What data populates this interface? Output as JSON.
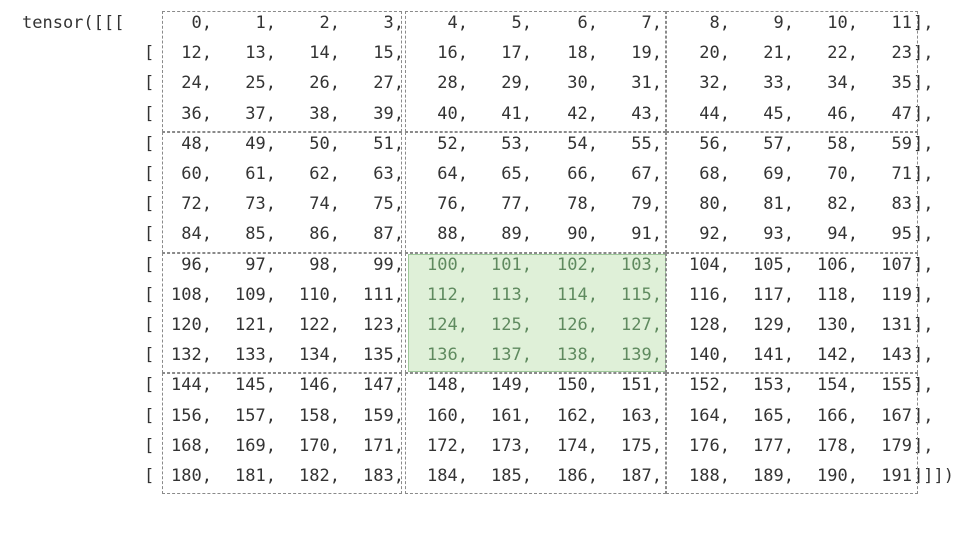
{
  "prefix": "tensor([[[",
  "suffix": "]])",
  "rows": [
    [
      "0",
      "1",
      "2",
      "3",
      "4",
      "5",
      "6",
      "7",
      "8",
      "9",
      "10",
      "11"
    ],
    [
      "12",
      "13",
      "14",
      "15",
      "16",
      "17",
      "18",
      "19",
      "20",
      "21",
      "22",
      "23"
    ],
    [
      "24",
      "25",
      "26",
      "27",
      "28",
      "29",
      "30",
      "31",
      "32",
      "33",
      "34",
      "35"
    ],
    [
      "36",
      "37",
      "38",
      "39",
      "40",
      "41",
      "42",
      "43",
      "44",
      "45",
      "46",
      "47"
    ],
    [
      "48",
      "49",
      "50",
      "51",
      "52",
      "53",
      "54",
      "55",
      "56",
      "57",
      "58",
      "59"
    ],
    [
      "60",
      "61",
      "62",
      "63",
      "64",
      "65",
      "66",
      "67",
      "68",
      "69",
      "70",
      "71"
    ],
    [
      "72",
      "73",
      "74",
      "75",
      "76",
      "77",
      "78",
      "79",
      "80",
      "81",
      "82",
      "83"
    ],
    [
      "84",
      "85",
      "86",
      "87",
      "88",
      "89",
      "90",
      "91",
      "92",
      "93",
      "94",
      "95"
    ],
    [
      "96",
      "97",
      "98",
      "99",
      "100",
      "101",
      "102",
      "103",
      "104",
      "105",
      "106",
      "107"
    ],
    [
      "108",
      "109",
      "110",
      "111",
      "112",
      "113",
      "114",
      "115",
      "116",
      "117",
      "118",
      "119"
    ],
    [
      "120",
      "121",
      "122",
      "123",
      "124",
      "125",
      "126",
      "127",
      "128",
      "129",
      "130",
      "131"
    ],
    [
      "132",
      "133",
      "134",
      "135",
      "136",
      "137",
      "138",
      "139",
      "140",
      "141",
      "142",
      "143"
    ],
    [
      "144",
      "145",
      "146",
      "147",
      "148",
      "149",
      "150",
      "151",
      "152",
      "153",
      "154",
      "155"
    ],
    [
      "156",
      "157",
      "158",
      "159",
      "160",
      "161",
      "162",
      "163",
      "164",
      "165",
      "166",
      "167"
    ],
    [
      "168",
      "169",
      "170",
      "171",
      "172",
      "173",
      "174",
      "175",
      "176",
      "177",
      "178",
      "179"
    ],
    [
      "180",
      "181",
      "182",
      "183",
      "184",
      "185",
      "186",
      "187",
      "188",
      "189",
      "190",
      "191"
    ]
  ],
  "highlighted_block": {
    "row_block": 2,
    "col_block": 1
  },
  "colors": {
    "text": "#333333",
    "highlight_fill": "#dff0d8",
    "highlight_text": "#5f8a5f",
    "dashed_border": "#8a8a8a"
  }
}
